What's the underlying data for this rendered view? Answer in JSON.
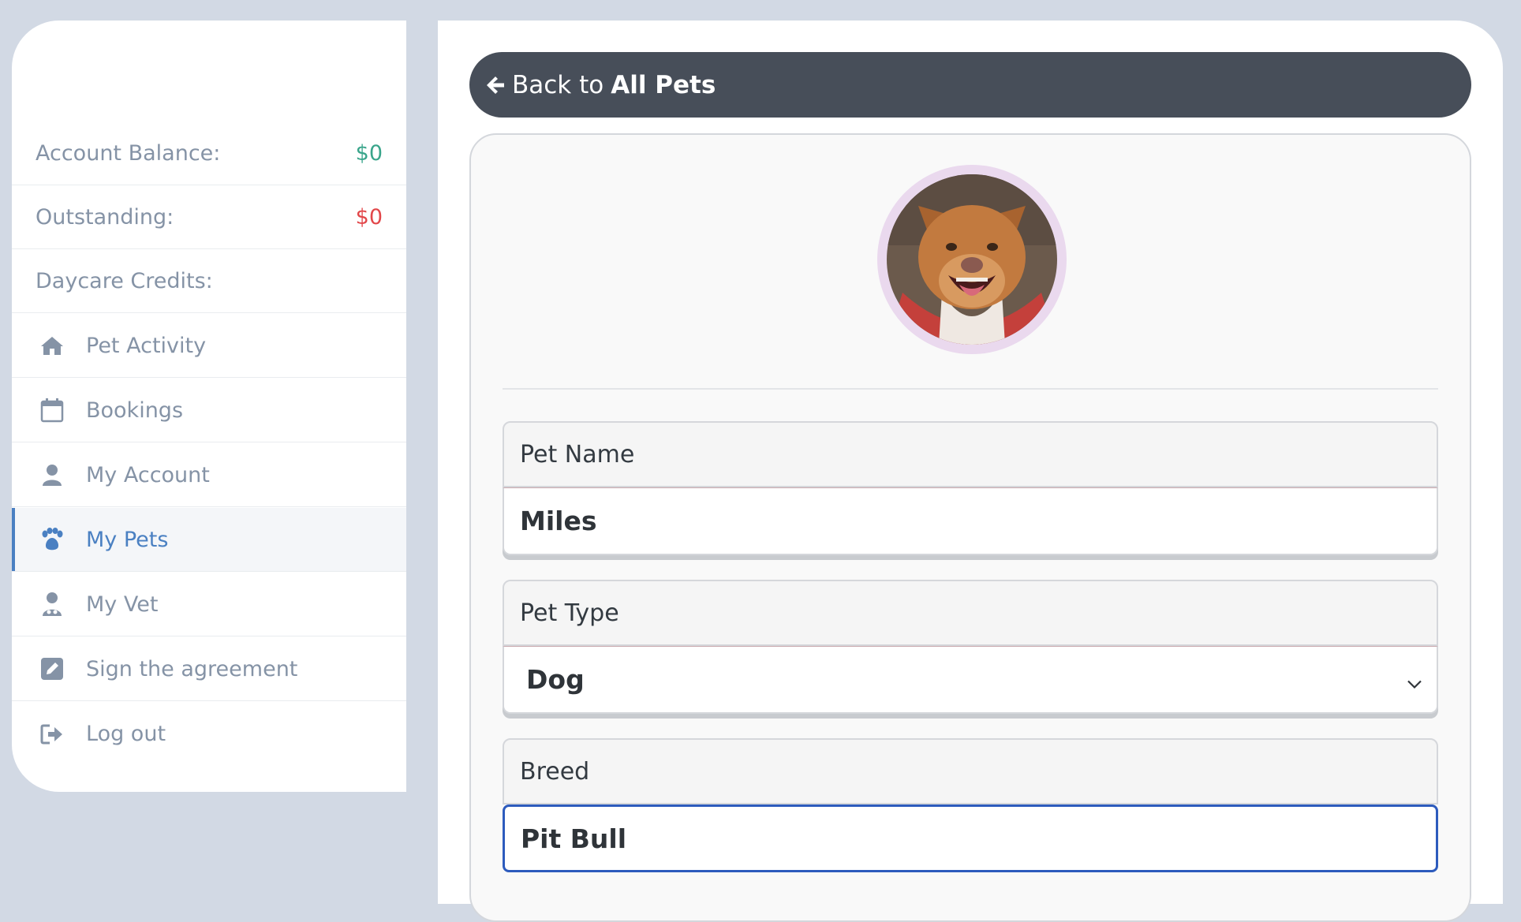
{
  "sidebar": {
    "balance": {
      "label": "Account Balance:",
      "value": "$0"
    },
    "outstanding": {
      "label": "Outstanding:",
      "value": "$0"
    },
    "credits": {
      "label": "Daycare Credits:"
    },
    "nav": [
      {
        "label": "Pet Activity",
        "icon": "home-icon"
      },
      {
        "label": "Bookings",
        "icon": "calendar-icon"
      },
      {
        "label": "My Account",
        "icon": "user-icon"
      },
      {
        "label": "My Pets",
        "icon": "paw-icon",
        "active": true
      },
      {
        "label": "My Vet",
        "icon": "doctor-icon"
      },
      {
        "label": "Sign the agreement",
        "icon": "edit-icon"
      },
      {
        "label": "Log out",
        "icon": "logout-icon"
      }
    ]
  },
  "main": {
    "back": {
      "prefix": "Back to",
      "target": "All Pets"
    },
    "fields": {
      "name": {
        "label": "Pet Name",
        "value": "Miles"
      },
      "type": {
        "label": "Pet Type",
        "value": "Dog"
      },
      "breed": {
        "label": "Breed",
        "value": "Pit Bull"
      }
    }
  },
  "colors": {
    "accent": "#4a80c2",
    "positive": "#3aa58b",
    "negative": "#e2474a",
    "back_button": "#474e59",
    "focus": "#2d5bbd"
  }
}
